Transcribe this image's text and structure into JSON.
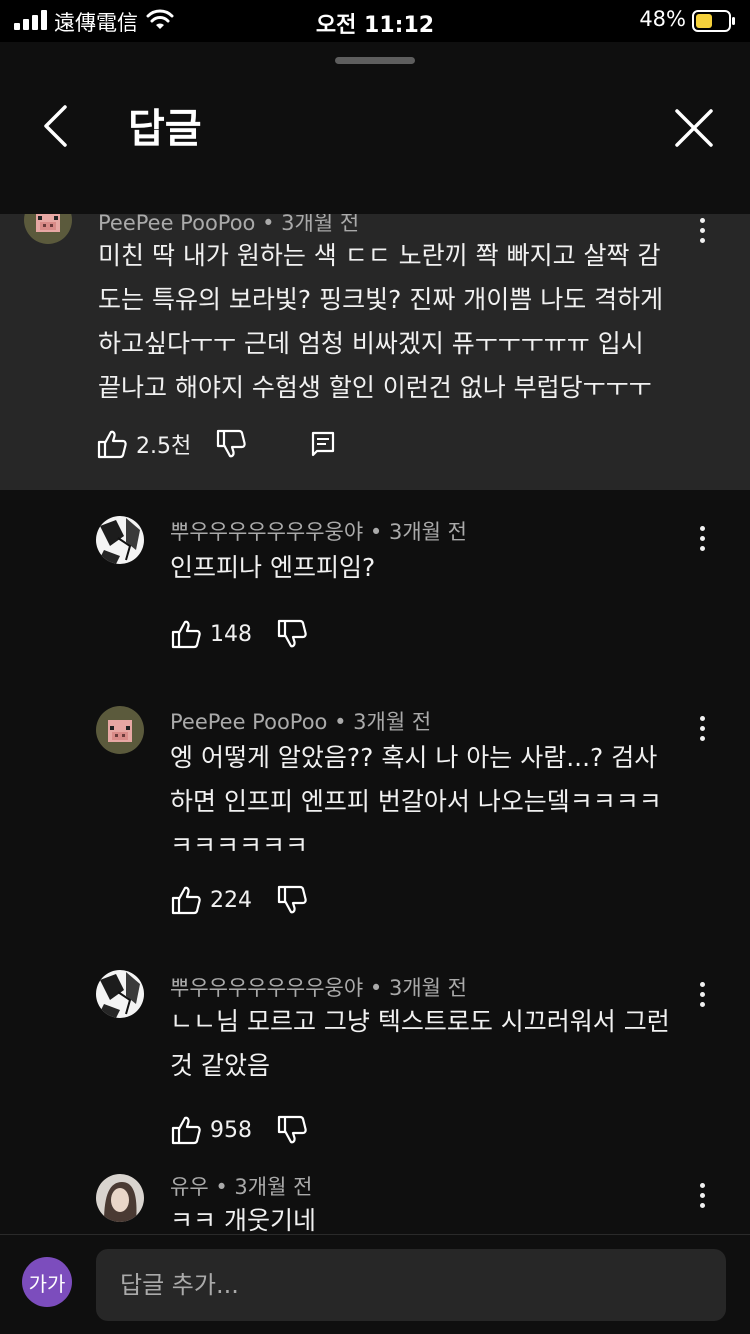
{
  "status_bar": {
    "carrier": "遠傳電信",
    "time": "오전 11:12",
    "battery": "48%"
  },
  "header": {
    "title": "답글",
    "back_icon": "chevron-left-icon",
    "close_icon": "close-icon"
  },
  "parent_comment": {
    "author": "PeePee PooPoo",
    "time": "3개월 전",
    "text_lines": [
      "미친 딱 내가 원하는 색 ㄷㄷ 노란끼 쫙 빠지고 살짝 감",
      "도는 특유의 보라빛? 핑크빛? 진짜 개이쁨 나도 격하게",
      "하고싶다ㅜㅜ 근데 엄청 비싸겠지 퓨ㅜㅜㅜㅠㅠ 입시",
      "끝나고 해야지 수험생 할인 이런건 없나 부럽당ㅜㅜㅜ"
    ],
    "likes": "2.5천"
  },
  "replies": [
    {
      "author": "뿌우우우우우우우웅야",
      "time": "3개월 전",
      "text_lines": [
        "인프피나 엔프피임?"
      ],
      "likes": "148",
      "avatar": "manga"
    },
    {
      "author": "PeePee PooPoo",
      "time": "3개월 전",
      "text_lines": [
        "엥 어떻게 알았음?? 혹시 나 아는 사람...? 검사",
        "하면 인프피 엔프피 번갈아서 나오는뎈ㅋㅋㅋㅋ",
        "ㅋㅋㅋㅋㅋㅋ"
      ],
      "likes": "224",
      "avatar": "pig"
    },
    {
      "author": "뿌우우우우우우우웅야",
      "time": "3개월 전",
      "text_lines": [
        "ㄴㄴ님 모르고 그냥 텍스트로도 시끄러워서 그런",
        "것 같았음"
      ],
      "likes": "958",
      "avatar": "manga"
    },
    {
      "author": "유우",
      "time": "3개월 전",
      "text_lines": [
        "ㅋㅋ 개웃기네"
      ],
      "likes": "",
      "avatar": "photo"
    }
  ],
  "reply_bar": {
    "my_avatar_label": "가가",
    "placeholder": "답글 추가..."
  },
  "colors": {
    "background": "#0f0f0f",
    "highlight": "#272727",
    "secondary_text": "#aaaaaa",
    "my_avatar": "#7c4dbd"
  }
}
